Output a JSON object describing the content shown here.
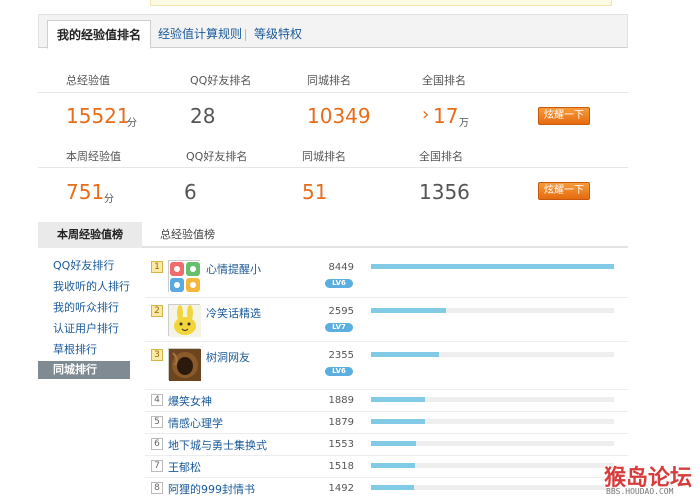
{
  "tabs": {
    "active": "我的经验值排名",
    "rules": "经验值计算规则",
    "privileges": "等级特权"
  },
  "total": {
    "labels": [
      "总经验值",
      "QQ好友排名",
      "同城排名",
      "全国排名"
    ],
    "exp_value": "15521",
    "exp_unit": "分",
    "qq_rank": "28",
    "city_rank": "10349",
    "nation_prefix": "›",
    "nation_rank": "17",
    "nation_unit": "万",
    "show_button": "炫耀一下"
  },
  "weekly": {
    "labels": [
      "本周经验值",
      "QQ好友排名",
      "同城排名",
      "全国排名"
    ],
    "exp_value": "751",
    "exp_unit": "分",
    "qq_rank": "6",
    "city_rank": "51",
    "nation_rank": "1356",
    "show_button": "炫耀一下"
  },
  "section_tabs": {
    "active": "本周经验值榜",
    "other": "总经验值榜"
  },
  "sidebar": {
    "items": [
      "QQ好友排行",
      "我收听的人排行",
      "我的听众排行",
      "认证用户排行",
      "草根排行",
      "同城排行"
    ],
    "active_index": 5
  },
  "leaderboard": {
    "max": 8449,
    "rows": [
      {
        "rank": "1",
        "name": "心情提醒小",
        "score": 8449,
        "level": "LV6",
        "avatar": "grid-face-avatar"
      },
      {
        "rank": "2",
        "name": "冷笑话精选",
        "score": 2595,
        "level": "LV7",
        "avatar": "yellow-rabbit-avatar"
      },
      {
        "rank": "3",
        "name": "树洞网友",
        "score": 2355,
        "level": "LV6",
        "avatar": "tree-hollow-avatar"
      },
      {
        "rank": "4",
        "name": "爆笑女神",
        "score": 1889
      },
      {
        "rank": "5",
        "name": "情感心理学",
        "score": 1879
      },
      {
        "rank": "6",
        "name": "地下城与勇士集换式",
        "score": 1553
      },
      {
        "rank": "7",
        "name": "王郁松",
        "score": 1518
      },
      {
        "rank": "8",
        "name": "阿狸的999封情书",
        "score": 1492
      }
    ]
  },
  "watermark": {
    "main": "猴岛论坛",
    "sub": "BBS.HOUDAO.COM"
  },
  "colors": {
    "accent_orange": "#e86c1a",
    "bar_blue": "#82cbe6",
    "link_blue": "#1a5a9a"
  }
}
